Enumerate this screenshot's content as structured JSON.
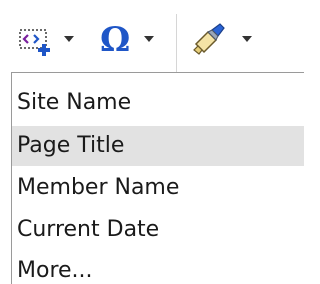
{
  "toolbar": {
    "buttons": [
      {
        "name": "insert-field",
        "icon": "insert-field-icon"
      },
      {
        "name": "symbol",
        "icon": "omega-icon",
        "glyph": "Ω"
      },
      {
        "name": "style",
        "icon": "brush-icon"
      }
    ],
    "accent_color": "#1f56c7"
  },
  "menu": {
    "items": [
      {
        "label": "Site Name",
        "selected": false
      },
      {
        "label": "Page Title",
        "selected": true
      },
      {
        "label": "Member Name",
        "selected": false
      },
      {
        "label": "Current Date",
        "selected": false
      },
      {
        "label": "More...",
        "selected": false
      }
    ],
    "selected_bg": "#e2e2e2"
  }
}
